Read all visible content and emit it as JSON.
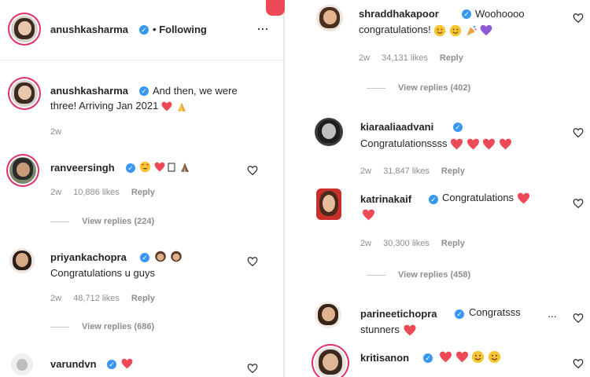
{
  "left": {
    "header": {
      "username": "anushkasharma",
      "dot": "•",
      "following": "Following",
      "more": "···"
    },
    "caption": {
      "username": "anushkasharma",
      "text": "And then, we were three! Arriving Jan 2021",
      "time": "2w"
    },
    "comments": [
      {
        "username": "ranveersingh",
        "text": "",
        "time": "2w",
        "likes": "10,886 likes",
        "reply": "Reply",
        "view_replies": "View replies (224)"
      },
      {
        "username": "priyankachopra",
        "text": "Congratulations u guys",
        "time": "2w",
        "likes": "48,712 likes",
        "reply": "Reply",
        "view_replies": "View replies (686)"
      },
      {
        "username": "varundvn",
        "text": ""
      }
    ]
  },
  "right": {
    "comments": [
      {
        "username": "shraddhakapoor",
        "text_line1": "Woohoooo",
        "text_line2": "congratulations!",
        "time": "2w",
        "likes": "34,131 likes",
        "reply": "Reply",
        "view_replies": "View replies (402)"
      },
      {
        "username": "kiaraaliaadvani",
        "text": "Congratulationssss",
        "time": "2w",
        "likes": "31,847 likes",
        "reply": "Reply"
      },
      {
        "username": "katrinakaif",
        "text": "Congratulations",
        "time": "2w",
        "likes": "30,300 likes",
        "reply": "Reply",
        "view_replies": "View replies (458)"
      },
      {
        "username": "parineetichopra",
        "text_line1": "Congratsss",
        "text_line2": "stunners",
        "more": "···"
      },
      {
        "username": "kritisanon",
        "text": ""
      }
    ]
  },
  "colors": {
    "heart": "#ed4956",
    "verified": "#3897f0",
    "muted": "#8e8e8e",
    "ring": "#e1306c"
  },
  "icons": [
    "verified-badge-icon",
    "heart-outline-icon",
    "red-heart-emoji",
    "folded-hands-emoji",
    "heart-eyes-emoji",
    "smiling-emoji",
    "purple-heart-emoji",
    "more-options-icon"
  ]
}
